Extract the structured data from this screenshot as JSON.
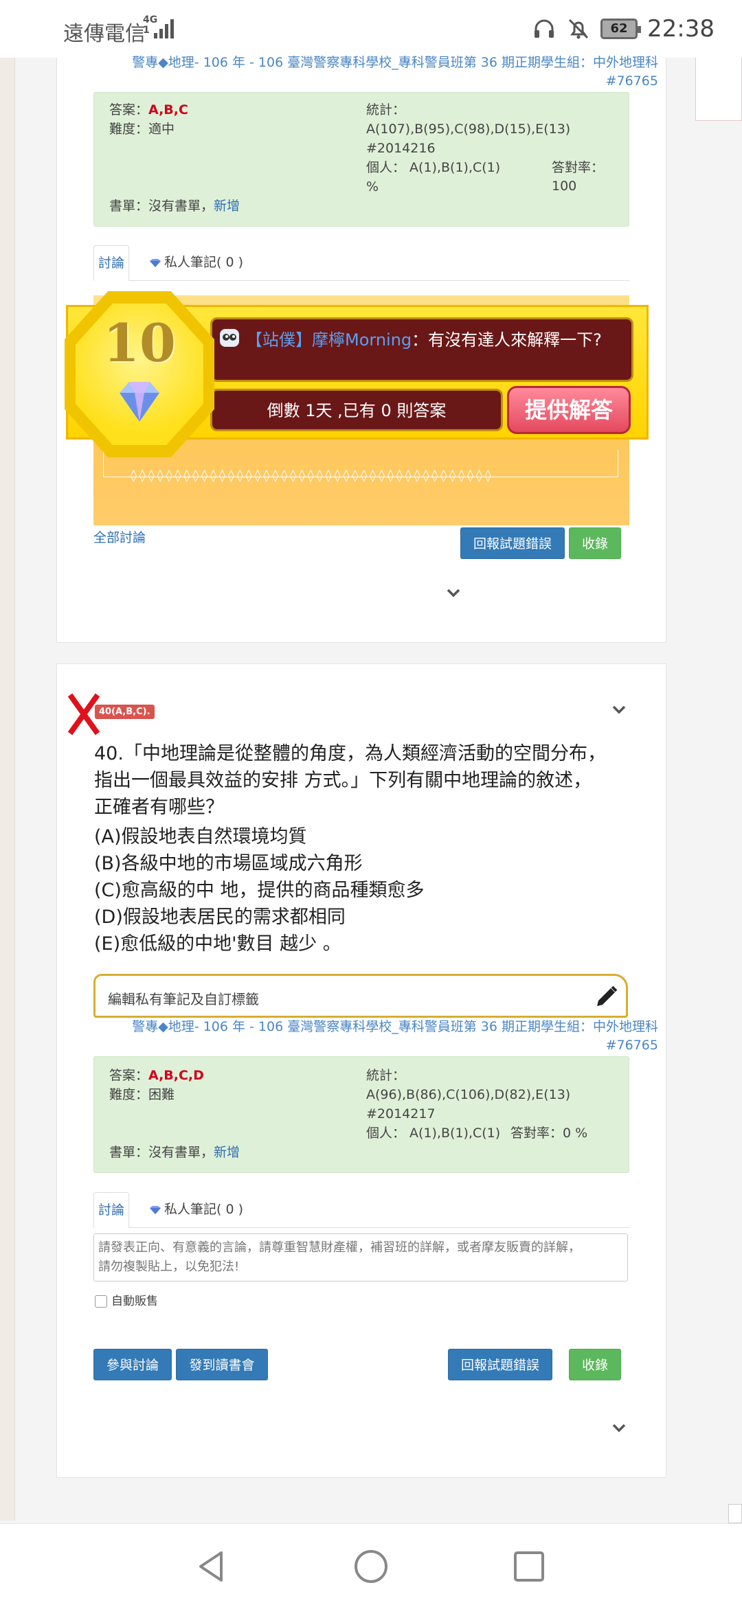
{
  "status_bar": {
    "carrier": "遠傳電信",
    "network_top": "4G",
    "network_bottom": "1",
    "battery": "62",
    "time": "22:38",
    "icons": [
      "headset-icon",
      "bell-muted-icon",
      "battery-icon",
      "signal-icon"
    ]
  },
  "card1": {
    "source_line1": "警專◆地理- 106 年 - 106 臺灣警察專科學校_專科警員班第 36 期正期學生組：中外地理科",
    "source_line2": "#76765",
    "answer_label": "答案：",
    "answer_value": "A,B,C",
    "difficulty_label": "難度：",
    "difficulty_value": "適中",
    "stats_label": "統計：",
    "stats_values": "A(107),B(95),C(98),D(15),E(13)",
    "stats_id": "#2014216",
    "personal": "個人： A(1),B(1),C(1)",
    "accuracy_label": "答對率：100",
    "accuracy_unit": "%",
    "booklist_label": "書單：沒有書單，",
    "booklist_add": "新增",
    "tab_discussion": "討論",
    "tab_notes": "私人筆記( 0 )",
    "promo": {
      "reward_number": "10",
      "message_user": "【站僕】摩檸Morning",
      "message_text": "：有沒有達人來解釋一下?",
      "countdown": "倒數 1天 ,已有 0 則答案",
      "answer_button": "提供解答"
    },
    "all_discussion": "全部討論",
    "report_button": "回報試題錯誤",
    "collect_button": "收錄"
  },
  "card2": {
    "badge": "40(A,B,C).",
    "question_lines": [
      "40.「中地理論是從整體的角度，為人類經濟活動的空間分布，",
      "指出一個最具效益的安排 方式。」下列有關中地理論的敘述，",
      "正確者有哪些？"
    ],
    "options": [
      "(A)假設地表自然環境均質",
      "(B)各級中地的市場區域成六角形",
      "(C)愈高級的中 地，提供的商品種類愈多",
      "(D)假設地表居民的需求都相同",
      "(E)愈低級的中地'數目 越少 。"
    ],
    "note_bar": "編輯私有筆記及自訂標籤",
    "source_line1": "警專◆地理- 106 年 - 106 臺灣警察專科學校_專科警員班第 36 期正期學生組：中外地理科",
    "source_line2": "#76765",
    "answer_label": "答案：",
    "answer_value": "A,B,C,D",
    "difficulty_label": "難度：",
    "difficulty_value": "困難",
    "stats_label": "統計：",
    "stats_values": "A(96),B(86),C(106),D(82),E(13)",
    "stats_id": "#2014217",
    "personal": "個人： A(1),B(1),C(1)",
    "accuracy": "答對率：0 %",
    "booklist_label": "書單：沒有書單，",
    "booklist_add": "新增",
    "tab_discussion": "討論",
    "tab_notes": "私人筆記( 0 )",
    "textarea_placeholder_line1": "請發表正向、有意義的言論，請尊重智慧財產權，補習班的詳解，或者摩友販賣的詳解，",
    "textarea_placeholder_line2": "請勿複製貼上，以免犯法!",
    "auto_sell": "自動販售",
    "join_button": "參與討論",
    "post_button": "發到讀書會",
    "report_button": "回報試題錯誤",
    "collect_button": "收錄"
  },
  "nav": {
    "icons": [
      "back-icon",
      "home-icon",
      "recents-icon"
    ]
  },
  "colors": {
    "answer_red": "#d0021b",
    "link_blue": "#2f6fb0",
    "green_box": "#dff0d8",
    "btn_blue": "#337ab7",
    "btn_green": "#5cb85c",
    "promo_yellow": "#ffd400",
    "promo_dark": "#6a1717"
  }
}
